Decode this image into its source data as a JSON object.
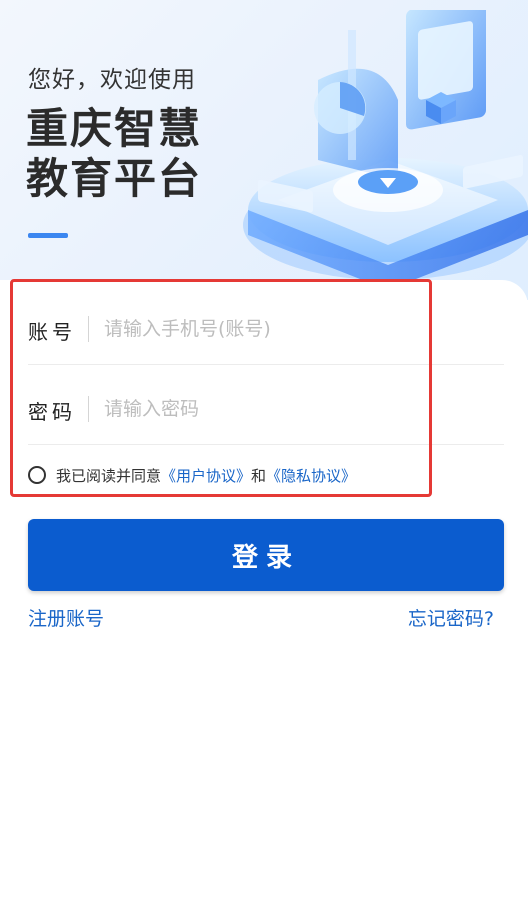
{
  "hero": {
    "greeting": "您好，欢迎使用",
    "title_line1": "重庆智慧",
    "title_line2": "教育平台",
    "illustration": "isometric-platform-illustration"
  },
  "form": {
    "account": {
      "label": "账号",
      "placeholder": "请输入手机号(账号)",
      "value": ""
    },
    "password": {
      "label": "密码",
      "placeholder": "请输入密码",
      "value": ""
    },
    "agreement": {
      "checked": false,
      "prefix": "我已阅读并同意",
      "user_agreement": "《用户协议》",
      "conjunction": "和",
      "privacy_agreement": "《隐私协议》"
    }
  },
  "actions": {
    "login_label": "登录",
    "register_label": "注册账号",
    "forgot_label": "忘记密码?"
  },
  "colors": {
    "primary": "#0b5ccf",
    "link": "#1a66c8",
    "highlight_border": "#e53935"
  }
}
